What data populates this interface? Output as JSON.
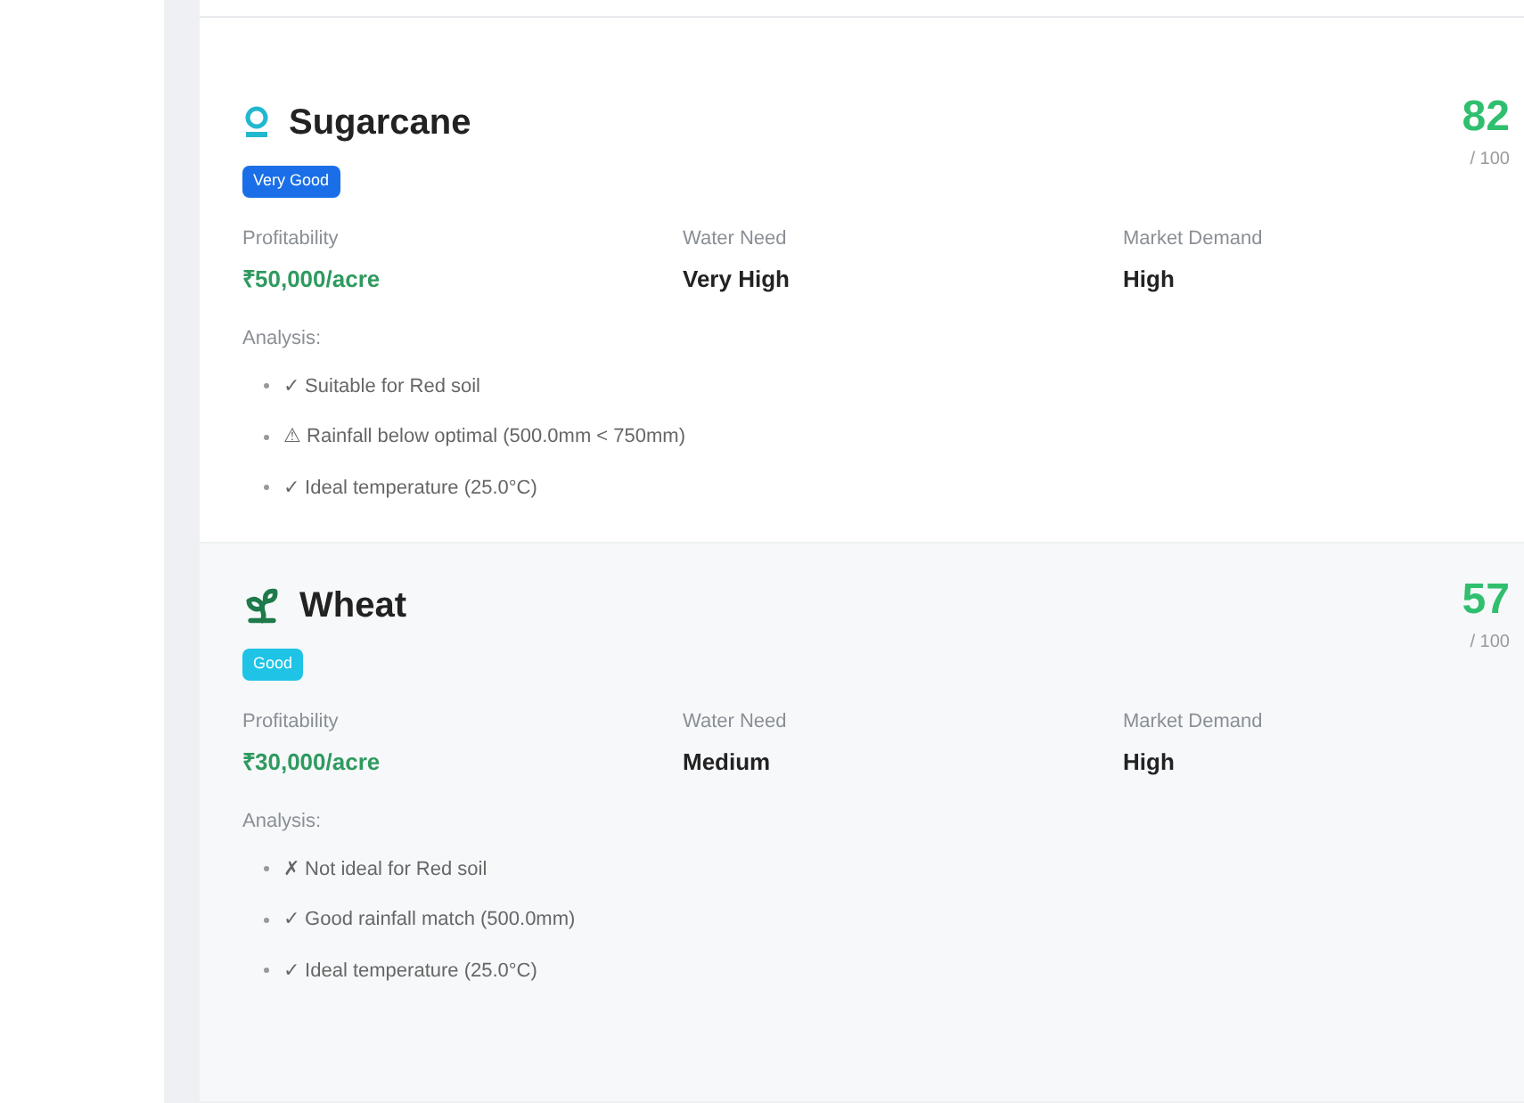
{
  "crops": [
    {
      "name": "Sugarcane",
      "rating": {
        "label": "Very Good",
        "color": "#1a6fe8"
      },
      "score": "82",
      "score_max": "/ 100",
      "metrics": [
        {
          "label": "Profitability",
          "value": "₹50,000/acre",
          "kind": "money"
        },
        {
          "label": "Water Need",
          "value": "Very High",
          "kind": "plain"
        },
        {
          "label": "Market Demand",
          "value": "High",
          "kind": "plain"
        }
      ],
      "analysis_label": "Analysis:",
      "analysis": [
        "✓ Suitable for Red soil",
        "⚠ Rainfall below optimal (500.0mm < 750mm)",
        "✓ Ideal temperature (25.0°C)"
      ]
    },
    {
      "name": "Wheat",
      "rating": {
        "label": "Good",
        "color": "#1ec3e6"
      },
      "score": "57",
      "score_max": "/ 100",
      "metrics": [
        {
          "label": "Profitability",
          "value": "₹30,000/acre",
          "kind": "money"
        },
        {
          "label": "Water Need",
          "value": "Medium",
          "kind": "plain"
        },
        {
          "label": "Market Demand",
          "value": "High",
          "kind": "plain"
        }
      ],
      "analysis_label": "Analysis:",
      "analysis": [
        "✗ Not ideal for Red soil",
        "✓ Good rainfall match (500.0mm)",
        "✓ Ideal temperature (25.0°C)"
      ]
    }
  ]
}
